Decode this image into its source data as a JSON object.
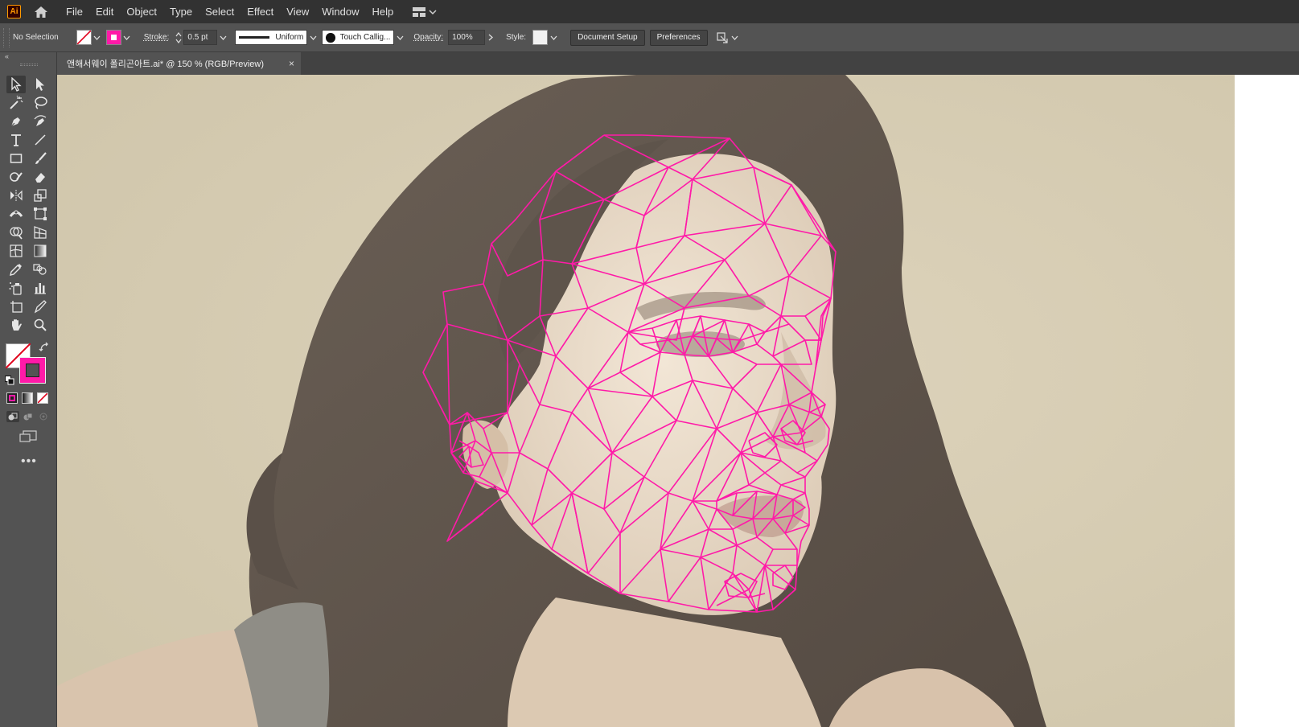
{
  "app": {
    "logo": "Ai"
  },
  "menu": [
    "File",
    "Edit",
    "Object",
    "Type",
    "Select",
    "Effect",
    "View",
    "Window",
    "Help"
  ],
  "control": {
    "selection": "No Selection",
    "stroke_label": "Stroke:",
    "stroke_weight": "0.5 pt",
    "profile": "Uniform",
    "brush": "Touch Callig...",
    "opacity_label": "Opacity:",
    "opacity": "100%",
    "style_label": "Style:",
    "document_setup": "Document Setup",
    "preferences": "Preferences"
  },
  "document": {
    "tab_title": "앤해서웨이 폴리곤아트.ai* @ 150 % (RGB/Preview)",
    "close": "×"
  },
  "colors": {
    "stroke_accent": "#ff1aa8",
    "ui_dark": "#323232",
    "ui_panel": "#535353",
    "photo_bg": "#d6cdb3",
    "hair": "#5c524a"
  },
  "icons": {
    "home": "home-icon",
    "workspace": "workspace-grid-icon",
    "selection": "selection-arrow-icon",
    "direct_selection": "direct-selection-icon",
    "magic_wand": "magic-wand-icon",
    "lasso": "lasso-icon",
    "pen": "pen-icon",
    "curvature": "curvature-icon",
    "type": "type-icon",
    "line": "line-segment-icon",
    "rectangle": "rectangle-icon",
    "paintbrush": "paintbrush-icon",
    "shaper": "shaper-icon",
    "eraser": "eraser-icon",
    "rotate": "reflect-icon",
    "scale": "scale-icon",
    "width": "width-icon",
    "free_transform": "free-transform-icon",
    "shape_builder": "shape-builder-icon",
    "perspective": "perspective-grid-icon",
    "mesh": "mesh-icon",
    "gradient": "gradient-icon",
    "eyedropper": "eyedropper-icon",
    "blend": "blend-icon",
    "symbol_sprayer": "symbol-sprayer-icon",
    "column_graph": "column-graph-icon",
    "artboard": "artboard-icon",
    "slice": "slice-icon",
    "hand": "hand-icon",
    "zoom": "zoom-icon",
    "more": "more-tools-icon"
  }
}
